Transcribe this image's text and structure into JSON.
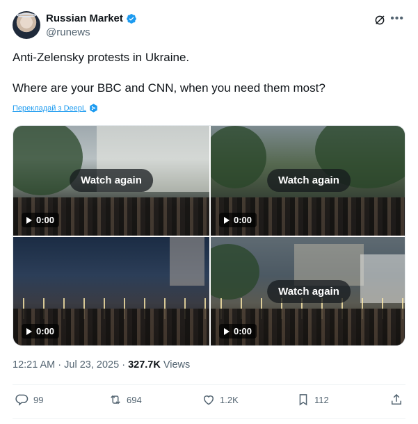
{
  "author": {
    "display_name": "Russian Market",
    "handle": "@runews",
    "verified": true,
    "verified_color": "#1d9bf0"
  },
  "tweet": {
    "line1": "Anti-Zelensky protests in Ukraine.",
    "line2": "Where are your BBC and CNN, when you need them most?",
    "translate_link": "Перекладай з DeepL"
  },
  "media": [
    {
      "watch_again": "Watch again",
      "duration": "0:00"
    },
    {
      "watch_again": "Watch again",
      "duration": "0:00"
    },
    {
      "duration": "0:00"
    },
    {
      "watch_again": "Watch again",
      "duration": "0:00"
    }
  ],
  "meta": {
    "time": "12:21 AM",
    "separator1": " · ",
    "date": "Jul 23, 2025",
    "separator2": " · ",
    "views_count": "327.7K",
    "views_label": " Views"
  },
  "actions": {
    "replies": "99",
    "reposts": "694",
    "likes": "1.2K",
    "bookmarks": "112"
  },
  "colors": {
    "accent": "#1d9bf0",
    "muted": "#536471",
    "text": "#0f1419"
  }
}
